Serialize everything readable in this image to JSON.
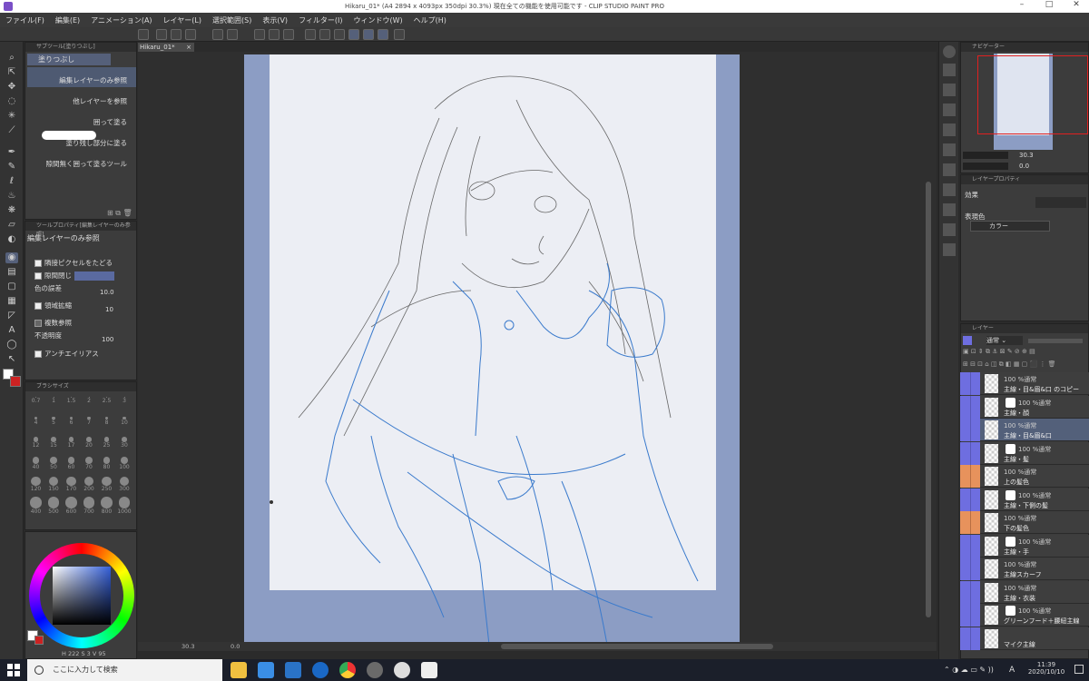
{
  "app": {
    "title": "Hikaru_01* (A4 2894 x 4093px 350dpi 30.3%) 現在全ての機能を使用可能です - CLIP STUDIO PAINT PRO"
  },
  "menu": [
    "ファイル(F)",
    "編集(E)",
    "アニメーション(A)",
    "レイヤー(L)",
    "選択範囲(S)",
    "表示(V)",
    "フィルター(I)",
    "ウィンドウ(W)",
    "ヘルプ(H)"
  ],
  "subtool": {
    "header": "サブツール[塗りつぶし]",
    "title": "塗りつぶし",
    "items": [
      "編集レイヤーのみ参照",
      "他レイヤーを参照",
      "囲って塗る",
      "塗り残し部分に塗る",
      "隙間無く囲って塗るツール"
    ]
  },
  "toolprop": {
    "header": "ツールプロパティ[編集レイヤーのみ参照]",
    "title": "編集レイヤーのみ参照",
    "rows": [
      {
        "label": "隣接ピクセルをたどる",
        "checked": true
      },
      {
        "label": "隙間閉じ",
        "checked": true
      },
      {
        "label": "色の誤差",
        "value": "10.0"
      },
      {
        "label": "領域拡縮",
        "checked": true,
        "value": "10"
      },
      {
        "label": "複数参照",
        "checked": false
      },
      {
        "label": "不透明度",
        "value": "100"
      },
      {
        "label": "アンチエイリアス",
        "checked": true
      }
    ]
  },
  "brushsize": {
    "header": "ブラシサイズ",
    "sizes": [
      "0.7",
      "1",
      "1.5",
      "2",
      "2.5",
      "3",
      "4",
      "5",
      "6",
      "7",
      "8",
      "10",
      "12",
      "15",
      "17",
      "20",
      "25",
      "30",
      "40",
      "50",
      "60",
      "70",
      "80",
      "100",
      "120",
      "150",
      "170",
      "200",
      "250",
      "300",
      "400",
      "500",
      "600",
      "700",
      "800",
      "1000"
    ]
  },
  "color": {
    "main": "#ffffff",
    "sub": "#cc2222",
    "readout": {
      "h": "222",
      "s": "3",
      "v": "95"
    }
  },
  "doc_tab": {
    "label": "Hikaru_01*"
  },
  "status": {
    "zoom": "30.3",
    "rotation": "0.0"
  },
  "navigator": {
    "header": "ナビゲーター",
    "zoom": "30.3",
    "angle": "0.0"
  },
  "layer_property": {
    "header": "レイヤープロパティ",
    "effect_label": "効果",
    "express_color_label": "表現色",
    "express_color_value": "カラー"
  },
  "layers_panel": {
    "header": "レイヤー",
    "blend_mode": "通常"
  },
  "layers": [
    {
      "opacity": "100 %通常",
      "name": "主線・目&眉&口 のコピー",
      "color": "blue",
      "mask": false,
      "selected": false
    },
    {
      "opacity": "100 %通常",
      "name": "主線・顔",
      "color": "blue",
      "mask": true,
      "selected": false
    },
    {
      "opacity": "100 %通常",
      "name": "主線・目&眉&口",
      "color": "blue",
      "mask": false,
      "selected": true
    },
    {
      "opacity": "100 %通常",
      "name": "主線・髪",
      "color": "blue",
      "mask": true,
      "selected": false
    },
    {
      "opacity": "100 %通常",
      "name": "上の髪色",
      "color": "orange",
      "mask": false,
      "selected": false
    },
    {
      "opacity": "100 %通常",
      "name": "主線・下側の髪",
      "color": "blue",
      "mask": true,
      "selected": false
    },
    {
      "opacity": "100 %通常",
      "name": "下の髪色",
      "color": "orange",
      "mask": false,
      "selected": false
    },
    {
      "opacity": "100 %通常",
      "name": "主線・手",
      "color": "blue",
      "mask": true,
      "selected": false
    },
    {
      "opacity": "100 %通常",
      "name": "主線スカーフ",
      "color": "blue",
      "mask": false,
      "selected": false
    },
    {
      "opacity": "100 %通常",
      "name": "主線・衣装",
      "color": "blue",
      "mask": false,
      "selected": false
    },
    {
      "opacity": "100 %通常",
      "name": "グリーンフード＋腰紐主線",
      "color": "blue",
      "mask": true,
      "selected": false
    },
    {
      "opacity": "",
      "name": "マイク主線",
      "color": "blue",
      "mask": false,
      "selected": false
    }
  ],
  "taskbar": {
    "search_placeholder": "ここに入力して検索",
    "time": "11:39",
    "date": "2020/10/10",
    "ime": "A"
  }
}
